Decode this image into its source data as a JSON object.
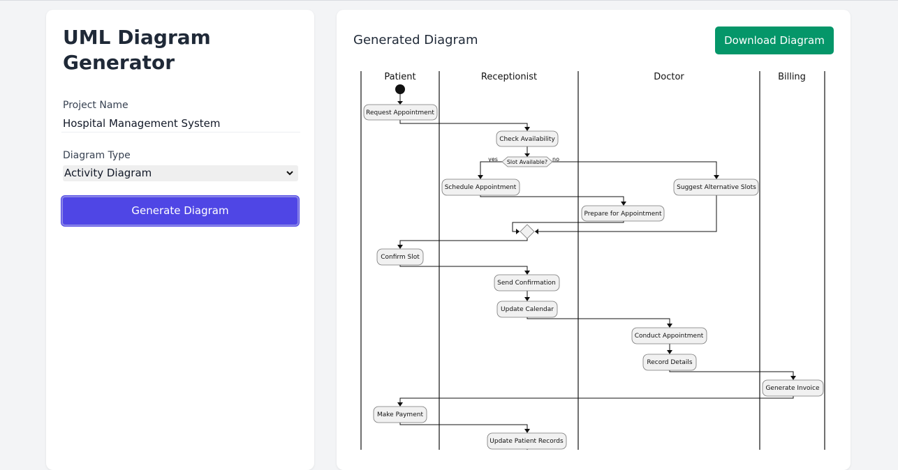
{
  "sidebar": {
    "title": "UML Diagram Generator",
    "project_label": "Project Name",
    "project_value": "Hospital Management System",
    "type_label": "Diagram Type",
    "type_value": "Activity Diagram",
    "generate_label": "Generate Diagram"
  },
  "main": {
    "title": "Generated Diagram",
    "download_label": "Download Diagram"
  },
  "diagram": {
    "lanes": [
      "Patient",
      "Receptionist",
      "Doctor",
      "Billing"
    ],
    "activities": {
      "request": "Request Appointment",
      "check": "Check Availability",
      "decision": "Slot Available?",
      "yes": "yes",
      "no": "no",
      "schedule": "Schedule Appointment",
      "suggest": "Suggest Alternative Slots",
      "prepare": "Prepare for Appointment",
      "confirm": "Confirm Slot",
      "send": "Send Confirmation",
      "calendar": "Update Calendar",
      "conduct": "Conduct Appointment",
      "record": "Record Details",
      "invoice": "Generate Invoice",
      "payment": "Make Payment",
      "records": "Update Patient Records"
    }
  },
  "colors": {
    "primary_button": "#4f46e5",
    "download_button": "#059669",
    "background": "#f3f4f6"
  }
}
